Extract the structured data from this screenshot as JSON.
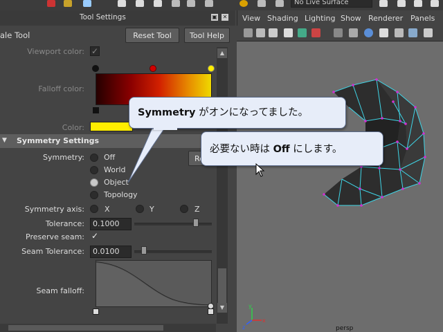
{
  "top": {
    "live_surface": "No Live Surface"
  },
  "panel": {
    "title": "Tool Settings",
    "tool_name": "ale Tool",
    "reset_tool": "Reset Tool",
    "tool_help": "Tool Help",
    "viewport_color_label": "Viewport color:",
    "falloff_color_label": "Falloff color:",
    "color_label": "Color:",
    "color_value": "#ffee00",
    "section_title": "Symmetry Settings",
    "reset_partial": "Re",
    "symmetry_label": "Symmetry:",
    "symmetry_options": [
      "Off",
      "World",
      "Object",
      "Topology"
    ],
    "symmetry_selected": "Object",
    "symmetry_axis_label": "Symmetry axis:",
    "axis_options": [
      "X",
      "Y",
      "Z"
    ],
    "tolerance_label": "Tolerance:",
    "tolerance_value": "0.1000",
    "tolerance_slider_fraction": 0.82,
    "preserve_seam_label": "Preserve seam:",
    "preserve_seam_checked": "✓",
    "seam_tolerance_label": "Seam Tolerance:",
    "seam_tolerance_value": "0.0100",
    "seam_tolerance_slider_fraction": 0.1,
    "seam_falloff_label": "Seam falloff:"
  },
  "viewport": {
    "menus": [
      "View",
      "Shading",
      "Lighting",
      "Show",
      "Renderer",
      "Panels"
    ],
    "camera_label": "persp",
    "wire_color": "#3fd6e8",
    "vertex_color": "#d030d0"
  },
  "bubbles": {
    "b1_bold": "Symmetry",
    "b1_text": " がオンになってました。",
    "b2_text_a": "必要ない時は ",
    "b2_bold": "Off",
    "b2_text_b": " にします。"
  }
}
